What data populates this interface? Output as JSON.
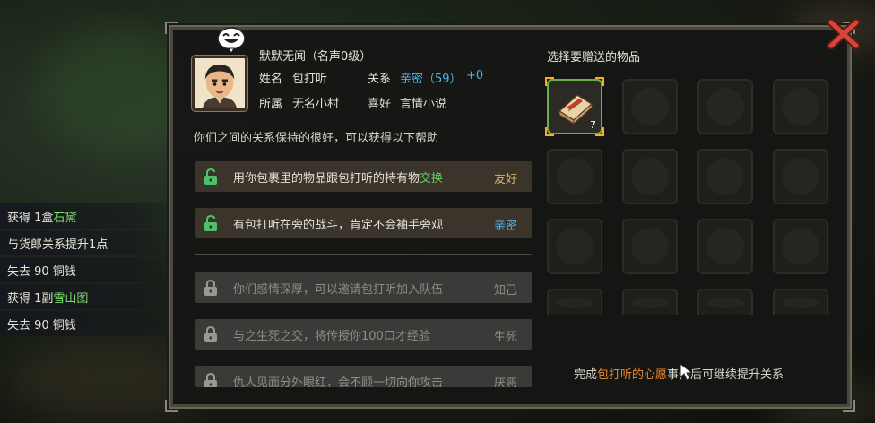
{
  "dialog": {
    "npc_title": "默默无闻（名声0级）",
    "name_label": "姓名",
    "name_value": "包打听",
    "relation_label": "关系",
    "relation_value": "亲密（59）",
    "relation_gain": "+0",
    "belong_label": "所属",
    "belong_value": "无名小村",
    "hobby_label": "喜好",
    "hobby_value": "言情小说",
    "intro_text": "你们之间的关系保持的很好，可以获得以下帮助",
    "benefits": [
      {
        "text_before": "用你包裹里的物品跟包打听的持有物",
        "highlight": "交换",
        "level": "友好",
        "locked": false
      },
      {
        "text": "有包打听在旁的战斗，肯定不会袖手旁观",
        "level": "亲密",
        "locked": false
      },
      {
        "text": "你们感情深厚，可以邀请包打听加入队伍",
        "level": "知己",
        "locked": true
      },
      {
        "text": "与之生死之交，将传授你100口才经验",
        "level": "生死",
        "locked": true
      },
      {
        "text": "仇人见面分外眼红，会不顾一切向你攻击",
        "level": "厌恶",
        "locked": true
      }
    ],
    "gift_title": "选择要赠送的物品",
    "gift_item": {
      "icon": "book-item-icon",
      "quantity": "7"
    },
    "footer_before": "完成",
    "footer_highlight": "包打听的心愿",
    "footer_after": "事件后可继续提升关系"
  },
  "log": [
    {
      "prefix": "获得 1盒",
      "item": "石黛",
      "suffix": ""
    },
    {
      "prefix": "与货郎关系提升1点",
      "item": "",
      "suffix": ""
    },
    {
      "prefix": "失去 90 铜钱",
      "item": "",
      "suffix": ""
    },
    {
      "prefix": "获得 1副",
      "item": "雪山图",
      "suffix": ""
    },
    {
      "prefix": "失去 90 铜钱",
      "item": "",
      "suffix": ""
    }
  ],
  "colors": {
    "relation": "#4fb2e6",
    "friendly": "#d4b36a",
    "highlight_green": "#5fd15f",
    "wish_orange": "#f08a30",
    "selected_border": "#f0b020"
  }
}
